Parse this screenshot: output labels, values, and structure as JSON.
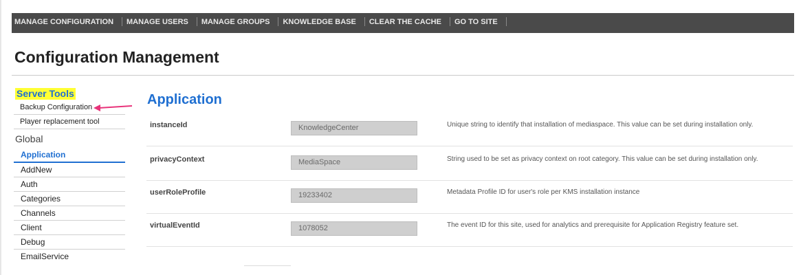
{
  "topnav": {
    "items": [
      "MANAGE CONFIGURATION",
      "MANAGE USERS",
      "MANAGE GROUPS",
      "KNOWLEDGE BASE",
      "CLEAR THE CACHE",
      "GO TO SITE"
    ]
  },
  "page": {
    "title": "Configuration Management"
  },
  "sidebar": {
    "server_tools_heading": "Server Tools",
    "server_tools": [
      "Backup Configuration",
      "Player replacement tool"
    ],
    "global_heading": "Global",
    "global_items": [
      "Application",
      "AddNew",
      "Auth",
      "Categories",
      "Channels",
      "Client",
      "Debug",
      "EmailService"
    ],
    "active_item": "Application",
    "highlight_color": "#ffff33",
    "arrow_color": "#e8337a"
  },
  "main": {
    "section_title": "Application",
    "accent_color": "#1f6fd1",
    "rows": [
      {
        "label": "instanceId",
        "value": "KnowledgeCenter",
        "description": "Unique string to identify that installation of mediaspace. This value can be set during installation only."
      },
      {
        "label": "privacyContext",
        "value": "MediaSpace",
        "description": "String used to be set as privacy context on root category. This value can be set during installation only."
      },
      {
        "label": "userRoleProfile",
        "value": "19233402",
        "description": "Metadata Profile ID for user's role per KMS installation instance"
      },
      {
        "label": "virtualEventId",
        "value": "1078052",
        "description": "The event ID for this site, used for analytics and prerequisite for Application Registry feature set."
      }
    ]
  }
}
